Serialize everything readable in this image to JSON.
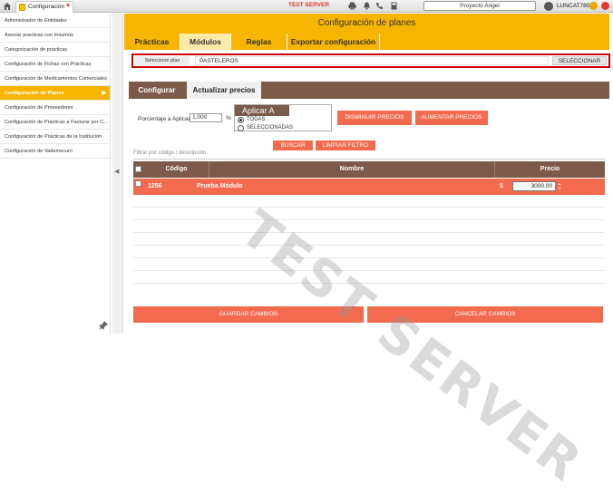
{
  "topbar": {
    "tab_label": "Configuración",
    "tab_close": "×",
    "server_label": "TEST SERVER",
    "project": "Proyecto Angel",
    "user": "LUNCAT780"
  },
  "sidebar": {
    "items": [
      {
        "label": "Administrador de Entidades"
      },
      {
        "label": "Asociar practicas con Insumos"
      },
      {
        "label": "Categorización de prácticas"
      },
      {
        "label": "Configuración de Fichas con Prácticas"
      },
      {
        "label": "Configuración de Medicamentos Comerciales"
      },
      {
        "label": "Configuración de Planes"
      },
      {
        "label": "Configuración de Proveedores"
      },
      {
        "label": "Configuración de Prácticas a Facturar por C..."
      },
      {
        "label": "Configuración de Prácticas de la Institución"
      },
      {
        "label": "Configuración de Vademecum"
      }
    ],
    "active_index": 5,
    "collapse_glyph": "◀"
  },
  "main": {
    "title": "Configuración de planes",
    "tabs": [
      {
        "label": "Prácticas"
      },
      {
        "label": "Módulos"
      },
      {
        "label": "Reglas"
      },
      {
        "label": "Exportar configuración"
      }
    ],
    "plan_label": "Seleccione plan",
    "plan_value": "PASTELEROS",
    "select_button": "SELECCIONAR",
    "subtabs": [
      {
        "label": "Configurar"
      },
      {
        "label": "Actualizar precios"
      }
    ],
    "percent_label": "Porcentaje a Aplicar",
    "percent_value": "1,000",
    "percent_sign": "%",
    "apply_legend": "Aplicar A",
    "apply_options": [
      {
        "label": "TODAS",
        "selected": true
      },
      {
        "label": "SELECCIONADAS",
        "selected": false
      }
    ],
    "decrease_button": "DISMINUIR PRECIOS",
    "increase_button": "AUMENTAR PRECIOS",
    "search_button": "BUSCAR",
    "clear_filter_button": "LIMPIAR FILTRO",
    "filter_placeholder": "Filtrar por código / descripción",
    "table": {
      "headers": [
        "Código",
        "Nombre",
        "Precio"
      ],
      "rows": [
        {
          "code": "1256",
          "name": "Prueba Módulo",
          "currency": "$",
          "price": "3000.00"
        }
      ]
    },
    "save_button": "GUARDAR CAMBIOS",
    "cancel_button": "CANCELAR CAMBIOS"
  },
  "watermark": "TEST SERVER",
  "colors": {
    "accent_yellow": "#f7b500",
    "header_brown": "#7b5a4a",
    "button_orange": "#f26b4e",
    "highlight_red": "#d40000"
  }
}
